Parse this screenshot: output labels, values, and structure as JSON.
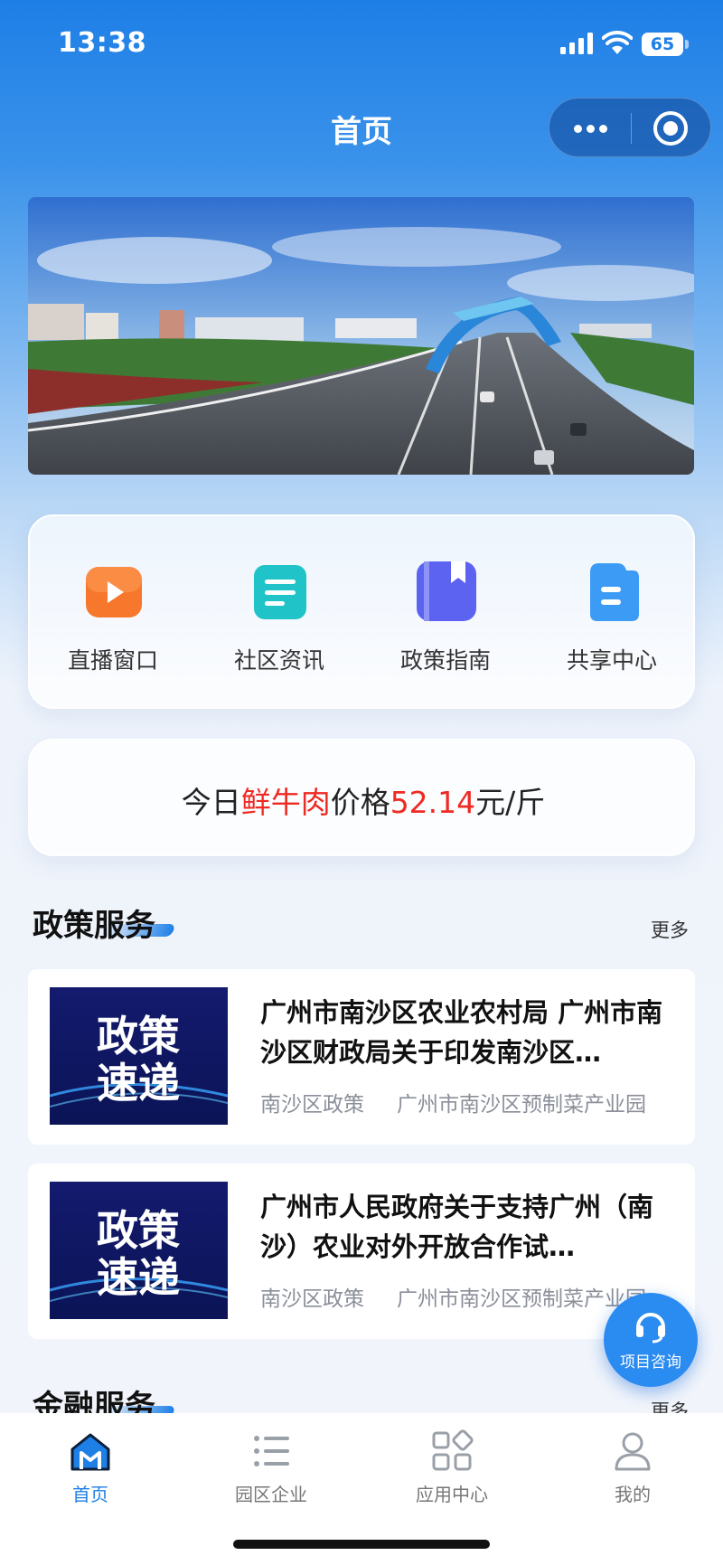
{
  "status_bar": {
    "time": "13:38",
    "battery": "65"
  },
  "nav": {
    "title": "首页"
  },
  "quick_links": [
    {
      "label": "直播窗口",
      "icon": "live-video-icon",
      "color": "#f7782c"
    },
    {
      "label": "社区资讯",
      "icon": "document-icon",
      "color": "#20c4c8"
    },
    {
      "label": "政策指南",
      "icon": "book-icon",
      "color": "#5b63f0"
    },
    {
      "label": "共享中心",
      "icon": "folder-icon",
      "color": "#3b9bf5"
    }
  ],
  "price": {
    "prefix": "今日",
    "item": "鲜牛肉",
    "mid": "价格",
    "value": "52.14",
    "unit": "元/斤"
  },
  "policy_section": {
    "title": "政策服务",
    "more": "更多"
  },
  "policies": [
    {
      "thumb_text": [
        "政策",
        "速递"
      ],
      "title": "广州市南沙区农业农村局 广州市南沙区财政局关于印发南沙区…",
      "tag1": "南沙区政策",
      "tag2": "广州市南沙区预制菜产业园"
    },
    {
      "thumb_text": [
        "政策",
        "速递"
      ],
      "title": "广州市人民政府关于支持广州（南沙）农业对外开放合作试…",
      "tag1": "南沙区政策",
      "tag2": "广州市南沙区预制菜产业园"
    }
  ],
  "finance_section": {
    "title": "金融服务",
    "more": "更多"
  },
  "consult": {
    "label": "项目咨询"
  },
  "tabs": [
    {
      "label": "首页",
      "icon": "home-icon",
      "active": true
    },
    {
      "label": "园区企业",
      "icon": "list-icon",
      "active": false
    },
    {
      "label": "应用中心",
      "icon": "apps-icon",
      "active": false
    },
    {
      "label": "我的",
      "icon": "user-icon",
      "active": false
    }
  ],
  "colors": {
    "accent": "#1e7fe6",
    "price_red": "#ee2a24"
  }
}
